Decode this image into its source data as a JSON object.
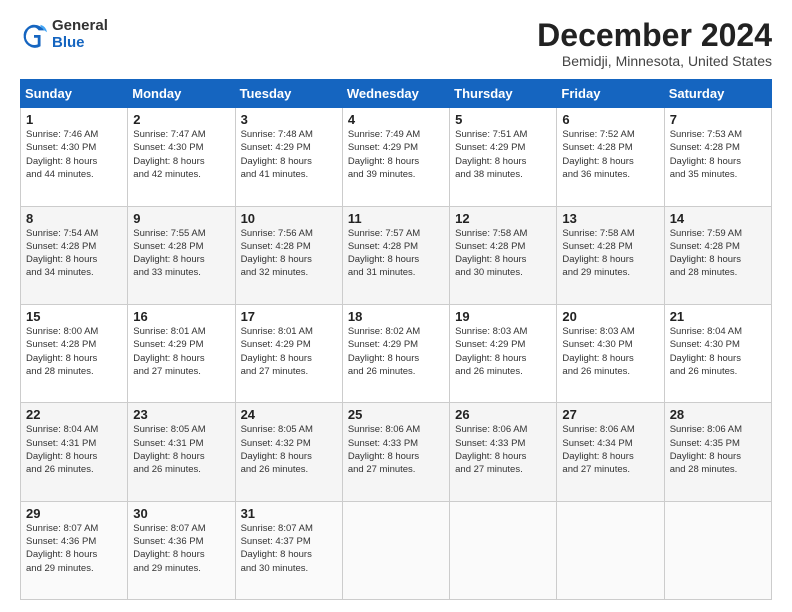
{
  "logo": {
    "general": "General",
    "blue": "Blue"
  },
  "title": "December 2024",
  "location": "Bemidji, Minnesota, United States",
  "days_header": [
    "Sunday",
    "Monday",
    "Tuesday",
    "Wednesday",
    "Thursday",
    "Friday",
    "Saturday"
  ],
  "weeks": [
    [
      {
        "day": "1",
        "lines": [
          "Sunrise: 7:46 AM",
          "Sunset: 4:30 PM",
          "Daylight: 8 hours",
          "and 44 minutes."
        ]
      },
      {
        "day": "2",
        "lines": [
          "Sunrise: 7:47 AM",
          "Sunset: 4:30 PM",
          "Daylight: 8 hours",
          "and 42 minutes."
        ]
      },
      {
        "day": "3",
        "lines": [
          "Sunrise: 7:48 AM",
          "Sunset: 4:29 PM",
          "Daylight: 8 hours",
          "and 41 minutes."
        ]
      },
      {
        "day": "4",
        "lines": [
          "Sunrise: 7:49 AM",
          "Sunset: 4:29 PM",
          "Daylight: 8 hours",
          "and 39 minutes."
        ]
      },
      {
        "day": "5",
        "lines": [
          "Sunrise: 7:51 AM",
          "Sunset: 4:29 PM",
          "Daylight: 8 hours",
          "and 38 minutes."
        ]
      },
      {
        "day": "6",
        "lines": [
          "Sunrise: 7:52 AM",
          "Sunset: 4:28 PM",
          "Daylight: 8 hours",
          "and 36 minutes."
        ]
      },
      {
        "day": "7",
        "lines": [
          "Sunrise: 7:53 AM",
          "Sunset: 4:28 PM",
          "Daylight: 8 hours",
          "and 35 minutes."
        ]
      }
    ],
    [
      {
        "day": "8",
        "lines": [
          "Sunrise: 7:54 AM",
          "Sunset: 4:28 PM",
          "Daylight: 8 hours",
          "and 34 minutes."
        ]
      },
      {
        "day": "9",
        "lines": [
          "Sunrise: 7:55 AM",
          "Sunset: 4:28 PM",
          "Daylight: 8 hours",
          "and 33 minutes."
        ]
      },
      {
        "day": "10",
        "lines": [
          "Sunrise: 7:56 AM",
          "Sunset: 4:28 PM",
          "Daylight: 8 hours",
          "and 32 minutes."
        ]
      },
      {
        "day": "11",
        "lines": [
          "Sunrise: 7:57 AM",
          "Sunset: 4:28 PM",
          "Daylight: 8 hours",
          "and 31 minutes."
        ]
      },
      {
        "day": "12",
        "lines": [
          "Sunrise: 7:58 AM",
          "Sunset: 4:28 PM",
          "Daylight: 8 hours",
          "and 30 minutes."
        ]
      },
      {
        "day": "13",
        "lines": [
          "Sunrise: 7:58 AM",
          "Sunset: 4:28 PM",
          "Daylight: 8 hours",
          "and 29 minutes."
        ]
      },
      {
        "day": "14",
        "lines": [
          "Sunrise: 7:59 AM",
          "Sunset: 4:28 PM",
          "Daylight: 8 hours",
          "and 28 minutes."
        ]
      }
    ],
    [
      {
        "day": "15",
        "lines": [
          "Sunrise: 8:00 AM",
          "Sunset: 4:28 PM",
          "Daylight: 8 hours",
          "and 28 minutes."
        ]
      },
      {
        "day": "16",
        "lines": [
          "Sunrise: 8:01 AM",
          "Sunset: 4:29 PM",
          "Daylight: 8 hours",
          "and 27 minutes."
        ]
      },
      {
        "day": "17",
        "lines": [
          "Sunrise: 8:01 AM",
          "Sunset: 4:29 PM",
          "Daylight: 8 hours",
          "and 27 minutes."
        ]
      },
      {
        "day": "18",
        "lines": [
          "Sunrise: 8:02 AM",
          "Sunset: 4:29 PM",
          "Daylight: 8 hours",
          "and 26 minutes."
        ]
      },
      {
        "day": "19",
        "lines": [
          "Sunrise: 8:03 AM",
          "Sunset: 4:29 PM",
          "Daylight: 8 hours",
          "and 26 minutes."
        ]
      },
      {
        "day": "20",
        "lines": [
          "Sunrise: 8:03 AM",
          "Sunset: 4:30 PM",
          "Daylight: 8 hours",
          "and 26 minutes."
        ]
      },
      {
        "day": "21",
        "lines": [
          "Sunrise: 8:04 AM",
          "Sunset: 4:30 PM",
          "Daylight: 8 hours",
          "and 26 minutes."
        ]
      }
    ],
    [
      {
        "day": "22",
        "lines": [
          "Sunrise: 8:04 AM",
          "Sunset: 4:31 PM",
          "Daylight: 8 hours",
          "and 26 minutes."
        ]
      },
      {
        "day": "23",
        "lines": [
          "Sunrise: 8:05 AM",
          "Sunset: 4:31 PM",
          "Daylight: 8 hours",
          "and 26 minutes."
        ]
      },
      {
        "day": "24",
        "lines": [
          "Sunrise: 8:05 AM",
          "Sunset: 4:32 PM",
          "Daylight: 8 hours",
          "and 26 minutes."
        ]
      },
      {
        "day": "25",
        "lines": [
          "Sunrise: 8:06 AM",
          "Sunset: 4:33 PM",
          "Daylight: 8 hours",
          "and 27 minutes."
        ]
      },
      {
        "day": "26",
        "lines": [
          "Sunrise: 8:06 AM",
          "Sunset: 4:33 PM",
          "Daylight: 8 hours",
          "and 27 minutes."
        ]
      },
      {
        "day": "27",
        "lines": [
          "Sunrise: 8:06 AM",
          "Sunset: 4:34 PM",
          "Daylight: 8 hours",
          "and 27 minutes."
        ]
      },
      {
        "day": "28",
        "lines": [
          "Sunrise: 8:06 AM",
          "Sunset: 4:35 PM",
          "Daylight: 8 hours",
          "and 28 minutes."
        ]
      }
    ],
    [
      {
        "day": "29",
        "lines": [
          "Sunrise: 8:07 AM",
          "Sunset: 4:36 PM",
          "Daylight: 8 hours",
          "and 29 minutes."
        ]
      },
      {
        "day": "30",
        "lines": [
          "Sunrise: 8:07 AM",
          "Sunset: 4:36 PM",
          "Daylight: 8 hours",
          "and 29 minutes."
        ]
      },
      {
        "day": "31",
        "lines": [
          "Sunrise: 8:07 AM",
          "Sunset: 4:37 PM",
          "Daylight: 8 hours",
          "and 30 minutes."
        ]
      },
      null,
      null,
      null,
      null
    ]
  ]
}
